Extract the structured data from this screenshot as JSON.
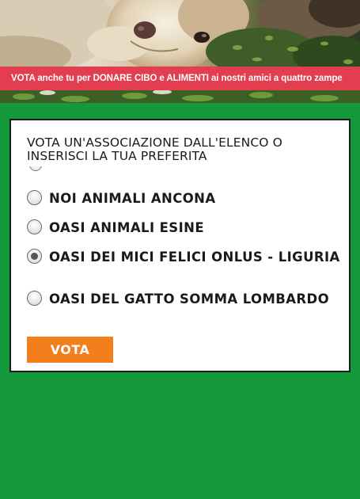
{
  "header": {
    "banner_text": "VOTA anche tu per DONARE CIBO e ALIMENTI ai nostri amici a quattro zampe"
  },
  "poll": {
    "question": "VOTA UN'ASSOCIAZIONE DALL'ELENCO O INSERISCI LA TUA PREFERITA",
    "options": [
      {
        "label": "NOI ANIMALI ANCONA",
        "selected": false
      },
      {
        "label": "OASI ANIMALI ESINE",
        "selected": false
      },
      {
        "label": "OASI DEI MICI FELICI ONLUS - LIGURIA",
        "selected": true
      },
      {
        "label": "OASI DEL GATTO SOMMA LOMBARDO",
        "selected": false
      }
    ],
    "submit_label": "VOTA"
  },
  "colors": {
    "page_background": "#149a3c",
    "banner": "#e23e4f",
    "button": "#f27f1b"
  }
}
